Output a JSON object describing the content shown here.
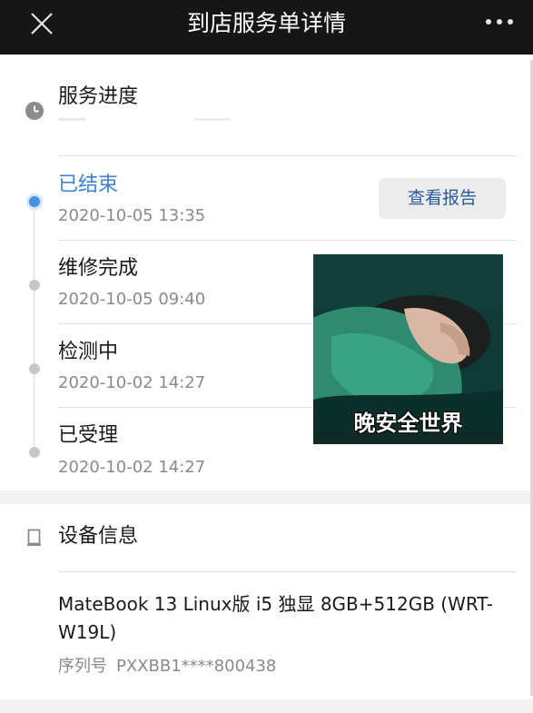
{
  "header": {
    "title": "到店服务单详情",
    "close_icon": "close-icon",
    "more_icon": "more-icon"
  },
  "progress": {
    "section_title": "服务进度",
    "section_icon": "clock-icon",
    "steps": [
      {
        "label": "已结束",
        "time": "2020-10-05 13:35",
        "active": true
      },
      {
        "label": "维修完成",
        "time": "2020-10-05 09:40",
        "active": false
      },
      {
        "label": "检测中",
        "time": "2020-10-02 14:27",
        "active": false
      },
      {
        "label": "已受理",
        "time": "2020-10-02 14:27",
        "active": false
      }
    ],
    "report_button": "查看报告",
    "accent_color": "#3b82d6"
  },
  "sticker": {
    "caption": "晚安全世界"
  },
  "device": {
    "section_title": "设备信息",
    "section_icon": "device-icon",
    "name": "MateBook 13 Linux版 i5 独显 8GB+512GB (WRT-W19L)",
    "serial_label": "序列号",
    "serial_value": "PXXBB1****800438"
  }
}
